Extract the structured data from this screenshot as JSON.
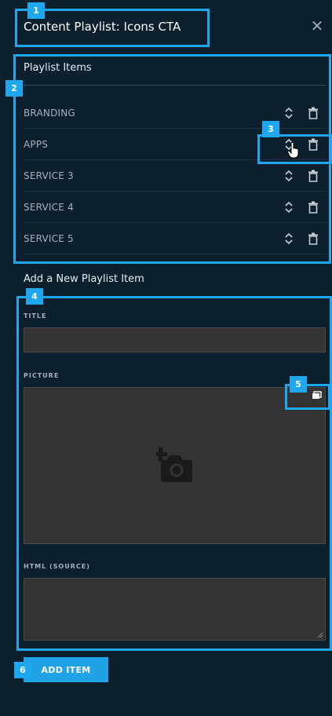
{
  "header": {
    "title": "Content Playlist: Icons CTA",
    "close_symbol": "✕"
  },
  "playlist": {
    "section_label": "Playlist Items",
    "items": [
      {
        "label": "BRANDING"
      },
      {
        "label": "APPS"
      },
      {
        "label": "SERVICE 3"
      },
      {
        "label": "SERVICE 4"
      },
      {
        "label": "SERVICE 5"
      }
    ],
    "row_icons": [
      "sort-icon",
      "trash-icon"
    ]
  },
  "new_item": {
    "section_label": "Add a New Playlist Item",
    "title_label": "TITLE",
    "title_value": "",
    "picture_label": "PICTURE",
    "html_label": "HTML (SOURCE)",
    "html_value": "",
    "add_button_label": "ADD ITEM",
    "icons": [
      "add-photo-icon",
      "gallery-icon"
    ]
  },
  "annotations": [
    "1",
    "2",
    "3",
    "4",
    "5",
    "6"
  ],
  "colors": {
    "background": "#0b1f2c",
    "accent": "#1ea7ee",
    "button": "#1fa3e6",
    "input_bg": "#333333"
  }
}
